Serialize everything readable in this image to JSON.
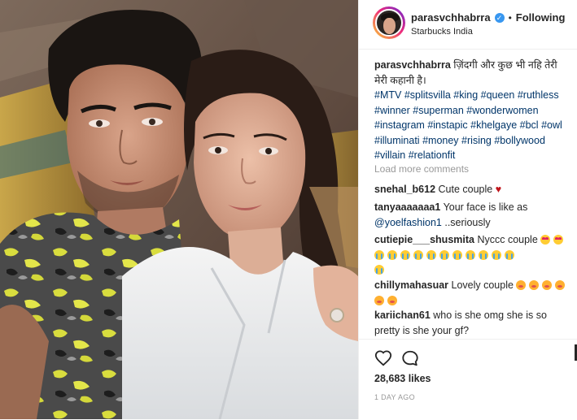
{
  "header": {
    "username": "parasvchhabrra",
    "verified_mark": "✓",
    "separator": "•",
    "follow_status": "Following",
    "location": "Starbucks India"
  },
  "caption": {
    "username": "parasvchhabrra",
    "text": " ज़िंदगी और कुछ भी नहि तेरी मेरी कहानी है।",
    "hashtags": [
      "#MTV",
      "#splitsvilla",
      "#king",
      "#queen",
      "#ruthless",
      "#winner",
      "#superman",
      "#wonderwomen",
      "#instagram",
      "#instapic",
      "#khelgaye",
      "#bcl",
      "#owl",
      "#illuminati",
      "#money",
      "#rising",
      "#bollywood",
      "#villain",
      "#relationfit"
    ]
  },
  "load_more_label": "Load more comments",
  "comments": [
    {
      "username": "snehal_b612",
      "text": " Cute couple ",
      "trail": "♥"
    },
    {
      "username": "tanyaaaaaaa1",
      "text": " Your face is like as ",
      "mention": "@yoelfashion1",
      "text2": " ..seriously"
    },
    {
      "username": "cutiepie___shusmita",
      "text": " Nyccc couple",
      "emojis": "2 heart-eyes, 12 crying faces"
    },
    {
      "username": "chillymahasuar",
      "text": " Lovely couple",
      "emojis": "6 flushed faces"
    },
    {
      "username": "kariichan61",
      "text": " who is she omg she is so pretty is she your gf?"
    }
  ],
  "actions": {
    "like_icon": "heart-outline-icon",
    "comment_icon": "comment-bubble-icon"
  },
  "likes_text": "28,683 likes",
  "timestamp": "1 DAY AGO",
  "colors": {
    "hashtag": "#003569",
    "verified": "#3897f0",
    "muted": "#999999",
    "heart": "#c0141b"
  }
}
